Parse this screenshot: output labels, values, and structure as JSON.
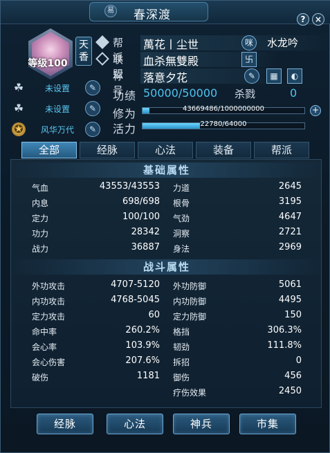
{
  "window": {
    "title": "春深渡",
    "title_icon": "易",
    "help_label": "?",
    "close_label": "×"
  },
  "profile": {
    "level_text": "等级100",
    "school_badge": "天香",
    "left_rows": [
      {
        "icon": "☘",
        "label": "未设置"
      },
      {
        "icon": "☘",
        "label": "未设置"
      },
      {
        "icon": "✪",
        "label": "风华万代"
      }
    ]
  },
  "info": {
    "guild_key": "帮派",
    "guild_value": "萬花丨尘世",
    "alliance_key": "联盟",
    "alliance_value": "血杀無雙殿",
    "title_key": "称号",
    "title_value": "落意夕花",
    "partner_icon": "咪",
    "partner_name": "水龙吟",
    "swastika_icon": "卐"
  },
  "merit": {
    "key": "功绩",
    "value": "50000/50000",
    "kill_key": "杀戮",
    "kill_value": "0"
  },
  "bars": {
    "cultivation_key": "修为",
    "cultivation_text": "43669486/1000000000",
    "cultivation_fraction": 0.044,
    "vitality_key": "活力",
    "vitality_text": "22780/64000",
    "vitality_fraction": 0.356
  },
  "tabs": [
    "全部",
    "经脉",
    "心法",
    "装备",
    "帮派"
  ],
  "basic": {
    "title": "基础属性",
    "left": [
      {
        "k": "气血",
        "v": "43553/43553"
      },
      {
        "k": "内息",
        "v": "698/698"
      },
      {
        "k": "定力",
        "v": "100/100"
      },
      {
        "k": "功力",
        "v": "28342"
      },
      {
        "k": "战力",
        "v": "36887"
      }
    ],
    "right": [
      {
        "k": "力道",
        "v": "2645"
      },
      {
        "k": "根骨",
        "v": "3195"
      },
      {
        "k": "气劲",
        "v": "4647"
      },
      {
        "k": "洞察",
        "v": "2721"
      },
      {
        "k": "身法",
        "v": "2969"
      }
    ]
  },
  "combat": {
    "title": "战斗属性",
    "left": [
      {
        "k": "外功攻击",
        "v": "4707-5120"
      },
      {
        "k": "内功攻击",
        "v": "4768-5045"
      },
      {
        "k": "定力攻击",
        "v": "60"
      },
      {
        "k": "命中率",
        "v": "260.2%"
      },
      {
        "k": "会心率",
        "v": "103.9%"
      },
      {
        "k": "会心伤害",
        "v": "207.6%"
      },
      {
        "k": "破伤",
        "v": "1181"
      }
    ],
    "right": [
      {
        "k": "外功防御",
        "v": "5061"
      },
      {
        "k": "内功防御",
        "v": "4495"
      },
      {
        "k": "定力防御",
        "v": "150"
      },
      {
        "k": "格挡",
        "v": "306.3%"
      },
      {
        "k": "韧劲",
        "v": "111.8%"
      },
      {
        "k": "拆招",
        "v": "0"
      },
      {
        "k": "御伤",
        "v": "456"
      },
      {
        "k": "疗伤效果",
        "v": "2450"
      }
    ]
  },
  "buttons": [
    "经脉",
    "心法",
    "神兵",
    "市集"
  ]
}
